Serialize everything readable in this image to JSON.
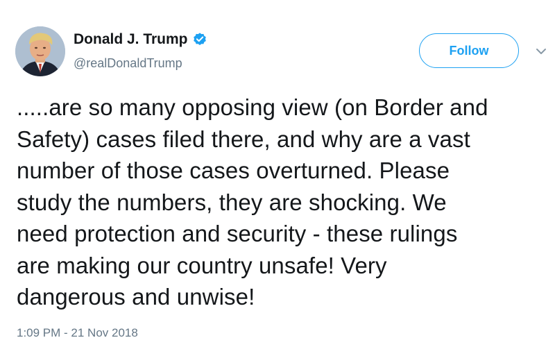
{
  "author": {
    "display_name": "Donald J. Trump",
    "handle": "@realDonaldTrump",
    "avatar_icon": "profile-photo",
    "verified_icon": "verified-badge-icon"
  },
  "actions": {
    "follow_label": "Follow",
    "more_icon": "chevron-down-icon"
  },
  "tweet": {
    "lines": [
      ".....are so many opposing view (on Border and",
      "Safety) cases filed there, and why are a vast",
      "number of those cases overturned. Please",
      "study the numbers, they are shocking. We",
      "need protection and security - these rulings",
      "are making our country unsafe! Very",
      "dangerous and unwise!"
    ],
    "timestamp": "1:09 PM - 21 Nov 2018"
  },
  "colors": {
    "accent": "#1da1f2",
    "text": "#14171a",
    "secondary_text": "#657786"
  }
}
